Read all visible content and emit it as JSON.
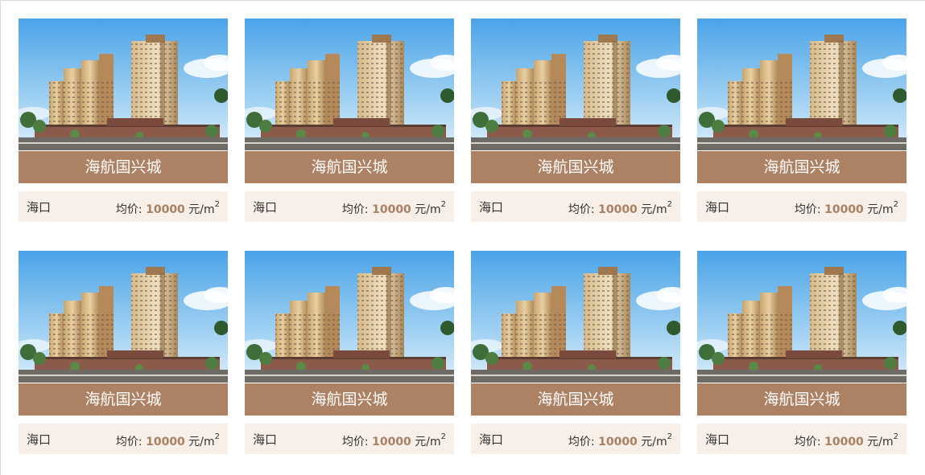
{
  "listings": [
    {
      "name": "海航国兴城",
      "location": "海口",
      "price_label": "均价:",
      "price": "10000",
      "unit": "元/m",
      "unit_sup": "2"
    },
    {
      "name": "海航国兴城",
      "location": "海口",
      "price_label": "均价:",
      "price": "10000",
      "unit": "元/m",
      "unit_sup": "2"
    },
    {
      "name": "海航国兴城",
      "location": "海口",
      "price_label": "均价:",
      "price": "10000",
      "unit": "元/m",
      "unit_sup": "2"
    },
    {
      "name": "海航国兴城",
      "location": "海口",
      "price_label": "均价:",
      "price": "10000",
      "unit": "元/m",
      "unit_sup": "2"
    },
    {
      "name": "海航国兴城",
      "location": "海口",
      "price_label": "均价:",
      "price": "10000",
      "unit": "元/m",
      "unit_sup": "2"
    },
    {
      "name": "海航国兴城",
      "location": "海口",
      "price_label": "均价:",
      "price": "10000",
      "unit": "元/m",
      "unit_sup": "2"
    },
    {
      "name": "海航国兴城",
      "location": "海口",
      "price_label": "均价:",
      "price": "10000",
      "unit": "元/m",
      "unit_sup": "2"
    },
    {
      "name": "海航国兴城",
      "location": "海口",
      "price_label": "均价:",
      "price": "10000",
      "unit": "元/m",
      "unit_sup": "2"
    }
  ],
  "colors": {
    "title_bar": "#ad8163",
    "info_bar": "#f7efe8",
    "price_accent": "#a98062"
  }
}
